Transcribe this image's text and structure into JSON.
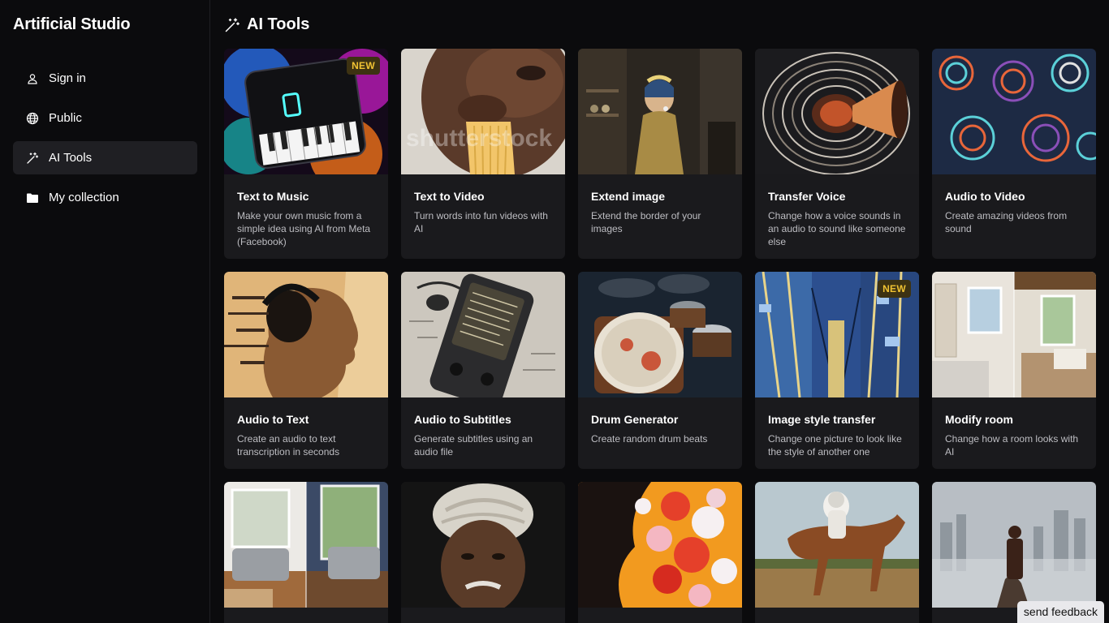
{
  "app": {
    "title": "Artificial Studio"
  },
  "sidebar": {
    "items": [
      {
        "label": "Sign in",
        "icon": "user-icon",
        "active": false
      },
      {
        "label": "Public",
        "icon": "globe-icon",
        "active": false
      },
      {
        "label": "AI Tools",
        "icon": "magic-wand-icon",
        "active": true
      },
      {
        "label": "My collection",
        "icon": "folder-icon",
        "active": false
      }
    ]
  },
  "header": {
    "title": "AI Tools",
    "icon": "magic-wand-icon"
  },
  "cards": [
    {
      "title": "Text to Music",
      "desc": "Make your own music from a simple idea using AI from Meta (Facebook)",
      "badge": "NEW"
    },
    {
      "title": "Text to Video",
      "desc": "Turn words into fun videos with AI",
      "watermark": "shutterstock"
    },
    {
      "title": "Extend image",
      "desc": "Extend the border of your images"
    },
    {
      "title": "Transfer Voice",
      "desc": "Change how a voice sounds in an audio to sound like someone else"
    },
    {
      "title": "Audio to Video",
      "desc": "Create amazing videos from sound"
    },
    {
      "title": "Audio to Text",
      "desc": "Create an audio to text transcription in seconds"
    },
    {
      "title": "Audio to Subtitles",
      "desc": "Generate subtitles using an audio file"
    },
    {
      "title": "Drum Generator",
      "desc": "Create random drum beats"
    },
    {
      "title": "Image style transfer",
      "desc": "Change one picture to look like the style of another one",
      "badge": "NEW"
    },
    {
      "title": "Modify room",
      "desc": "Change how a room looks with AI"
    },
    {
      "title": "",
      "desc": ""
    },
    {
      "title": "",
      "desc": ""
    },
    {
      "title": "",
      "desc": ""
    },
    {
      "title": "",
      "desc": ""
    },
    {
      "title": "",
      "desc": ""
    }
  ],
  "feedback": {
    "label": "send feedback"
  },
  "colors": {
    "background": "#0b0b0d",
    "card": "#1a1a1d",
    "active_nav": "#1f1f23",
    "badge_bg": "#3d3212",
    "badge_text": "#f0c233"
  }
}
